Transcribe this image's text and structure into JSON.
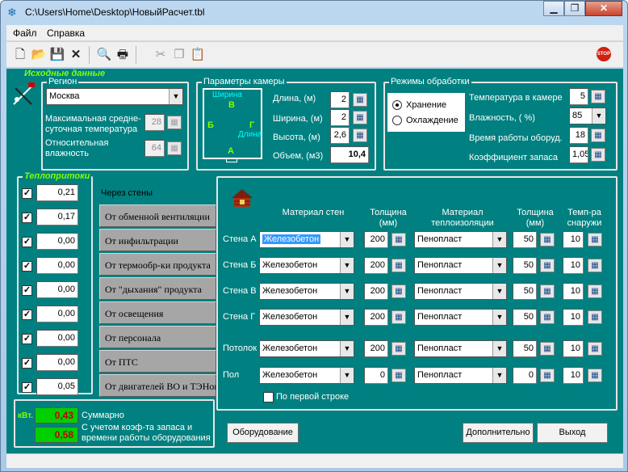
{
  "window": {
    "title": "C:\\Users\\Home\\Desktop\\НовыйРасчет.tbl"
  },
  "menu": {
    "file": "Файл",
    "help": "Справка"
  },
  "toolbar": {
    "icons": [
      "new-file-icon",
      "open-folder-icon",
      "save-icon",
      "close-x-icon",
      "print-preview-icon",
      "print-icon",
      "cut-icon",
      "copy-icon",
      "paste-icon",
      "stop-icon"
    ],
    "stop_label": "STOP"
  },
  "source": {
    "section_title": "Исходные данные",
    "region_label": "Регион",
    "region_value": "Москва",
    "avg_temp_label": "Максимальная средне-суточная температура",
    "avg_temp_value": "28",
    "humidity_label": "Относительная влажность",
    "humidity_value": "64"
  },
  "chamber": {
    "title": "Параметры камеры",
    "diagram": {
      "shirina": "Ширина",
      "b_top": "В",
      "b_left": "Б",
      "g_right": "Г",
      "dlina": "Длина",
      "a_bottom": "А"
    },
    "length_label": "Длина, (м)",
    "length_value": "2",
    "width_label": "Ширина, (м)",
    "width_value": "2",
    "height_label": "Высота, (м)",
    "height_value": "2,6",
    "volume_label": "Объем, (м3)",
    "volume_value": "10,4"
  },
  "modes": {
    "title": "Режимы обработки",
    "storage": "Хранение",
    "cooling": "Охлаждение",
    "temp_label": "Температура в камере",
    "temp_value": "5",
    "humidity_label": "Влажность, ( %)",
    "humidity_value": "85",
    "runtime_label": "Время работы оборуд.",
    "runtime_value": "18",
    "reserve_label": "Коэффициент запаса",
    "reserve_value": "1,05"
  },
  "heat": {
    "title": "Теплопритоки",
    "items": [
      {
        "value": "0,21",
        "label": "Через стены"
      },
      {
        "value": "0,17",
        "label": "От обменной вентиляции"
      },
      {
        "value": "0,00",
        "label": "От инфильтрации"
      },
      {
        "value": "0,00",
        "label": "От термообр-ки продукта"
      },
      {
        "value": "0,00",
        "label": "От \"дыхания\" продукта"
      },
      {
        "value": "0,00",
        "label": "От освещения"
      },
      {
        "value": "0,00",
        "label": "От персонала"
      },
      {
        "value": "0,00",
        "label": "От ПТС"
      },
      {
        "value": "0,05",
        "label": "От двигателей ВО и ТЭНов"
      }
    ]
  },
  "walls": {
    "headers": {
      "material": "Материал стен",
      "thickness": "Толщина (мм)",
      "insulation": "Материал теплоизоляции",
      "ins_thickness": "Толщина (мм)",
      "outside_temp": "Темп-ра снаружи"
    },
    "rows": [
      {
        "name": "Стена А",
        "material": "Железобетон",
        "thickness": "200",
        "insulation": "Пенопласт",
        "ins_thickness": "50",
        "temp": "10"
      },
      {
        "name": "Стена Б",
        "material": "Железобетон",
        "thickness": "200",
        "insulation": "Пенопласт",
        "ins_thickness": "50",
        "temp": "10"
      },
      {
        "name": "Стена В",
        "material": "Железобетон",
        "thickness": "200",
        "insulation": "Пенопласт",
        "ins_thickness": "50",
        "temp": "10"
      },
      {
        "name": "Стена Г",
        "material": "Железобетон",
        "thickness": "200",
        "insulation": "Пенопласт",
        "ins_thickness": "50",
        "temp": "10"
      },
      {
        "name": "Потолок",
        "material": "Железобетон",
        "thickness": "200",
        "insulation": "Пенопласт",
        "ins_thickness": "50",
        "temp": "10"
      },
      {
        "name": "Пол",
        "material": "Железобетон",
        "thickness": "0",
        "insulation": "Пенопласт",
        "ins_thickness": "0",
        "temp": "10"
      }
    ],
    "first_row_label": "По первой строке"
  },
  "summary": {
    "unit": "кВт.",
    "total_value": "0,43",
    "total_label": "Суммарно",
    "adjusted_value": "0,58",
    "adjusted_label": "С учетом коэф-та запаса и времени работы оборудования"
  },
  "buttons": {
    "equipment": "Оборудование",
    "additional": "Дополнительно",
    "exit": "Выход"
  }
}
